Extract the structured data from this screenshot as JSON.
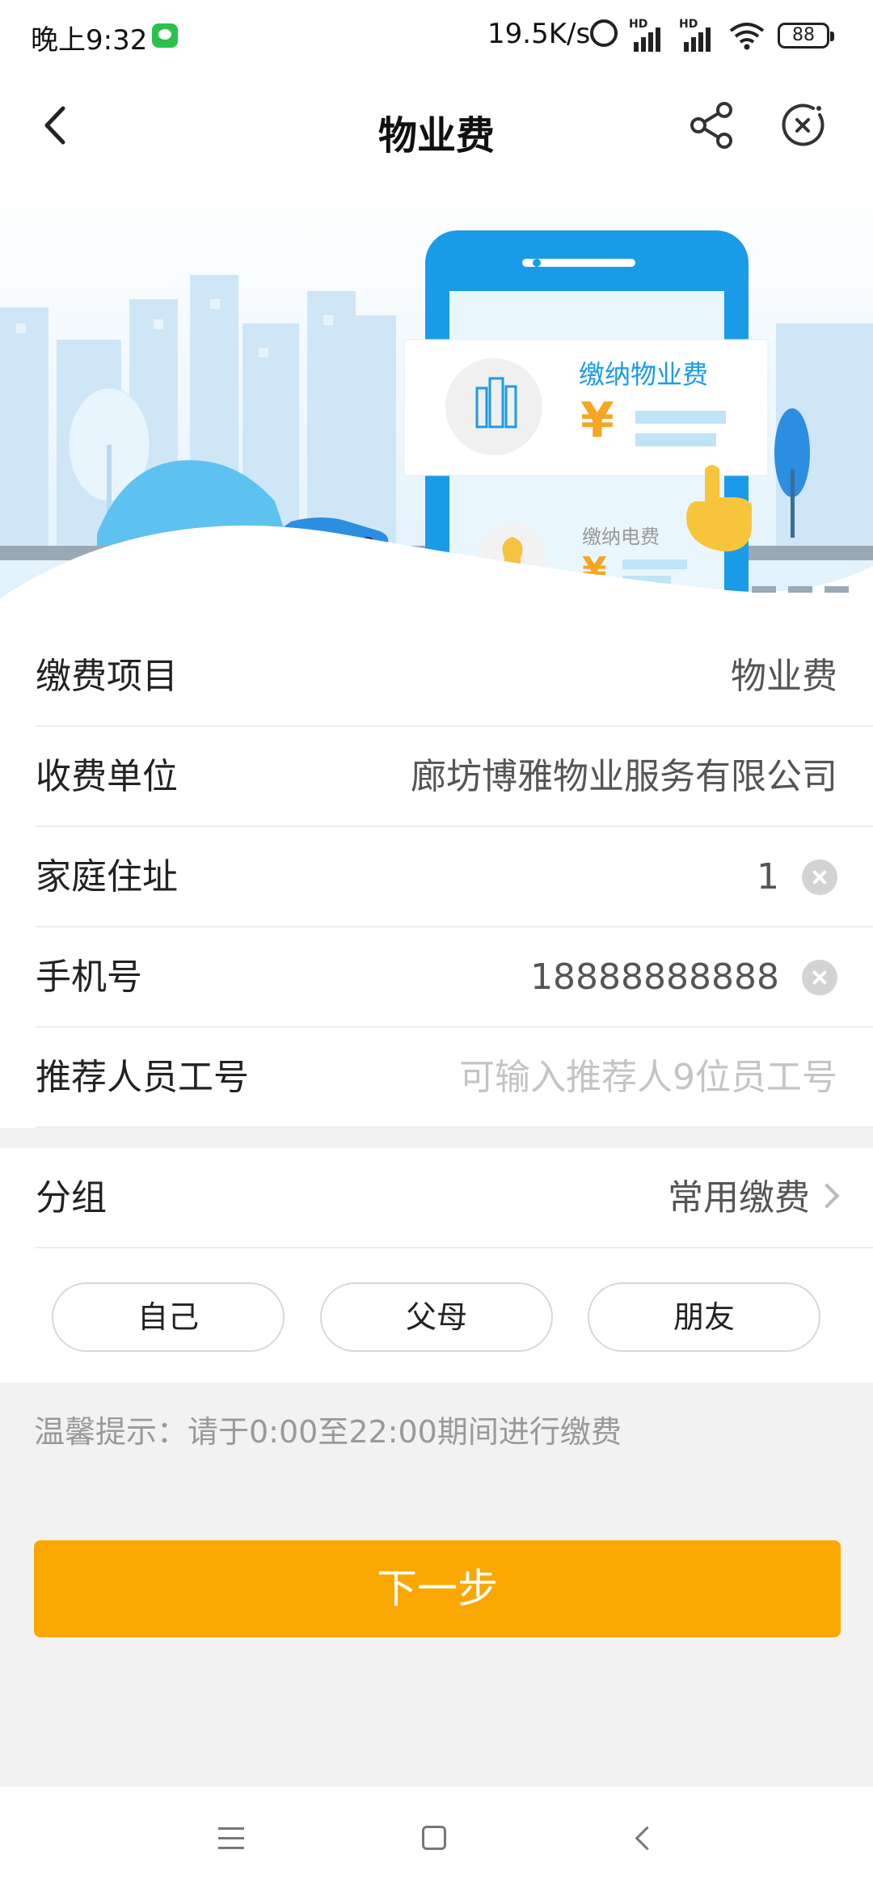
{
  "status_bar": {
    "time": "晚上9:32",
    "net_speed": "19.5K/s",
    "signal_label": "HD",
    "battery": "88"
  },
  "header": {
    "title": "物业费"
  },
  "banner": {
    "card_title": "缴纳物业费",
    "card_currency": "¥",
    "card2_title": "缴纳电费",
    "card2_currency": "¥",
    "accent_color": "#1a9be8"
  },
  "form": {
    "rows": [
      {
        "label": "缴费项目",
        "value": "物业费"
      },
      {
        "label": "收费单位",
        "value": "廊坊博雅物业服务有限公司"
      },
      {
        "label": "家庭住址",
        "value": "1"
      },
      {
        "label": "手机号",
        "value": "18888888888"
      },
      {
        "label": "推荐人员工号",
        "placeholder": "可输入推荐人9位员工号"
      }
    ]
  },
  "group": {
    "label": "分组",
    "value": "常用缴费",
    "chips": [
      "自己",
      "父母",
      "朋友"
    ]
  },
  "tip": "温馨提示：请于0:00至22:00期间进行缴费",
  "next_button": "下一步",
  "colors": {
    "primary_button": "#fba701",
    "background": "#f2f2f2"
  }
}
